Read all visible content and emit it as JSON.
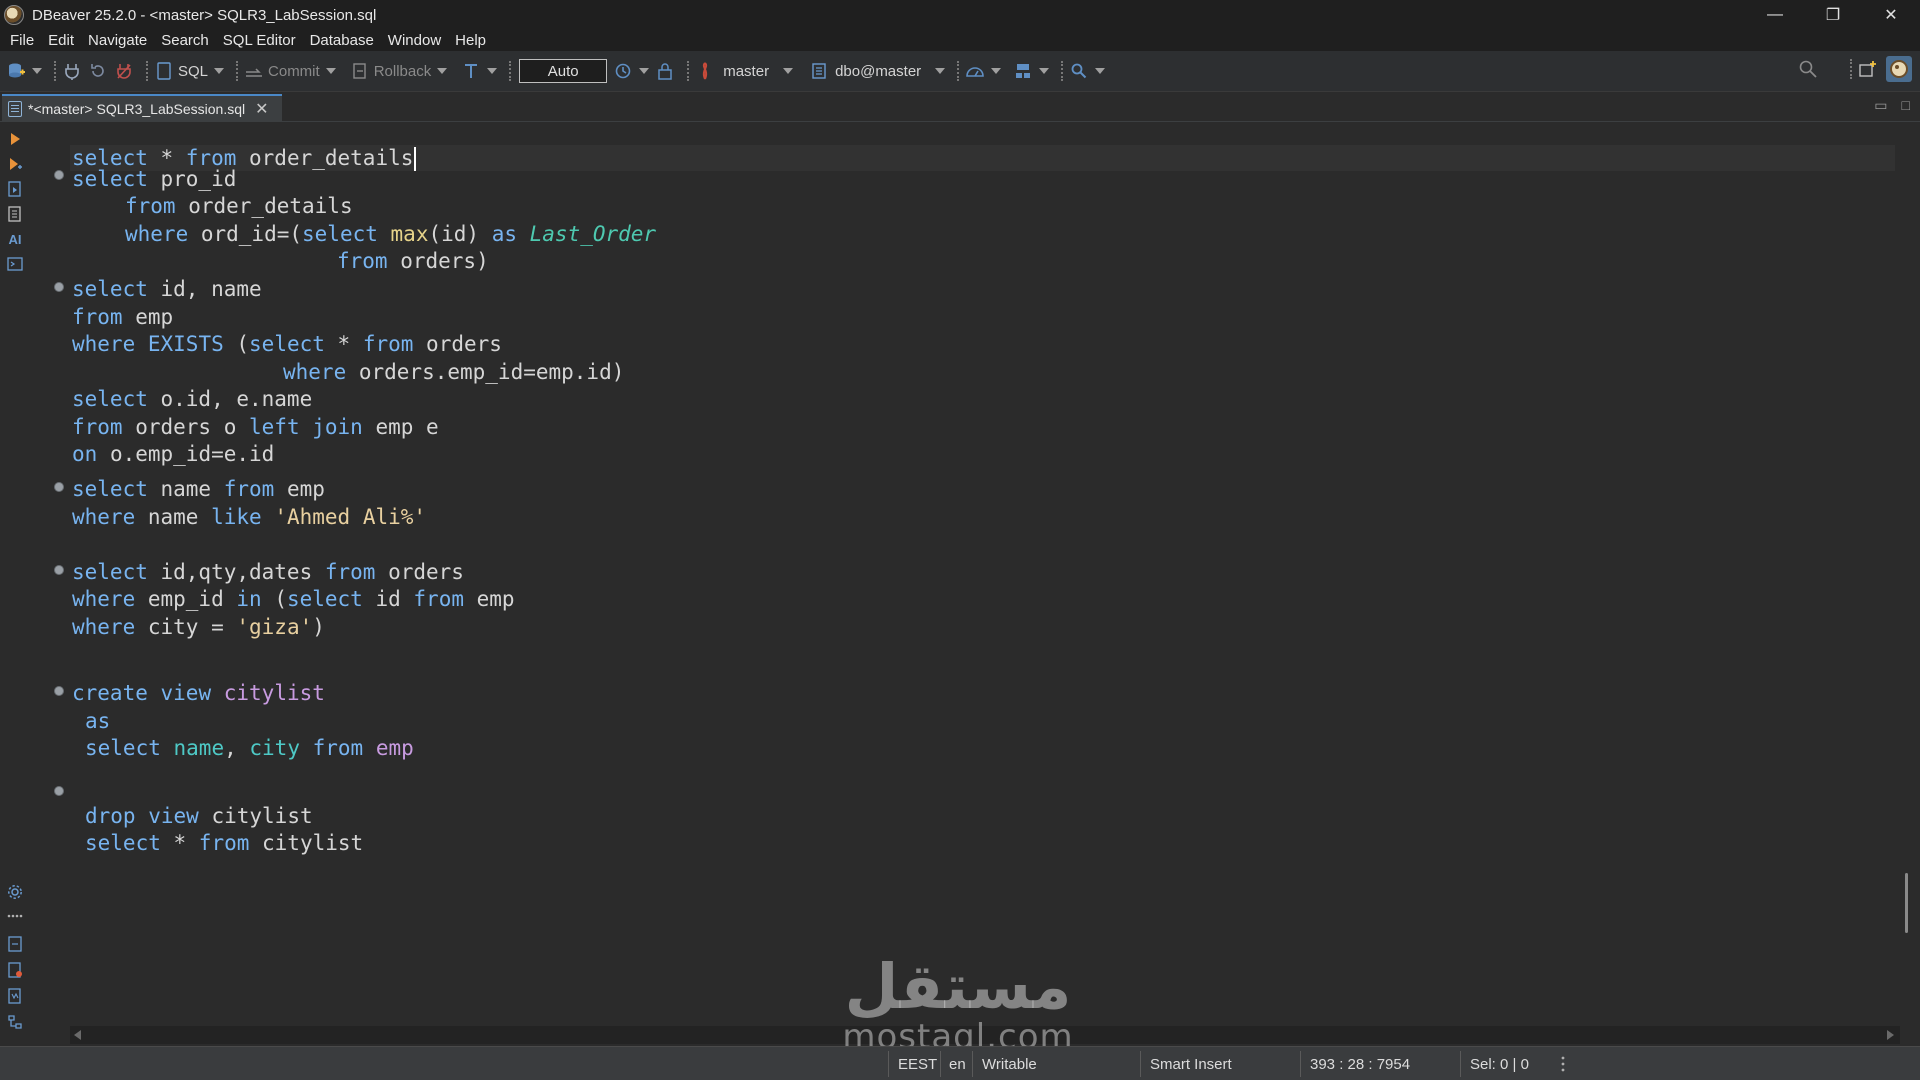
{
  "window": {
    "title": "DBeaver 25.2.0 - <master> SQLR3_LabSession.sql",
    "controls": {
      "minimize": "—",
      "restore": "❐",
      "close": "✕"
    }
  },
  "menu": [
    "File",
    "Edit",
    "Navigate",
    "Search",
    "SQL Editor",
    "Database",
    "Window",
    "Help"
  ],
  "toolbar": {
    "sql_label": "SQL",
    "commit_label": "Commit",
    "rollback_label": "Rollback",
    "transaction_mode": "Auto",
    "datasource": "master",
    "schema": "dbo@master"
  },
  "tab": {
    "label": "*<master> SQLR3_LabSession.sql",
    "close": "✕",
    "minimize": "▭",
    "maximize": "□"
  },
  "left_tools": {
    "ai_label": "AI"
  },
  "editor": {
    "line_1": {
      "kw1": "select",
      "t1": " * ",
      "kw2": "from",
      "t2": " order_details"
    },
    "block_subquery": {
      "l1": {
        "kw": "select",
        "t": " pro_id"
      },
      "l2": {
        "kw": "from",
        "t": " order_details"
      },
      "l3": {
        "kw1": "where",
        "t1": " ord_id=(",
        "kw2": "select",
        "sp": " ",
        "fn": "max",
        "t2": "(id) ",
        "kw3": "as",
        "sp2": " ",
        "alias": "Last_Order"
      },
      "l4": {
        "kw": "from",
        "t": " orders)"
      }
    },
    "block_exists": {
      "l1": {
        "kw": "select",
        "t": " id, name"
      },
      "l2": {
        "kw": "from",
        "t": " emp"
      },
      "l3": {
        "kw1": "where",
        "sp": " ",
        "kw2": "EXISTS",
        "t1": " (",
        "kw3": "select",
        "t2": " * ",
        "kw4": "from",
        "t3": " orders"
      },
      "l4": {
        "kw": "where",
        "t": " orders.emp_id=emp.id)"
      },
      "l5": {
        "kw": "select",
        "t": " o.id, e.name"
      },
      "l6": {
        "kw1": "from",
        "t1": " orders o ",
        "kw2": "left",
        "sp": " ",
        "kw3": "join",
        "t2": " emp e"
      },
      "l7": {
        "kw": "on",
        "t": " o.emp_id=e.id"
      }
    },
    "block_like": {
      "l1": {
        "kw1": "select",
        "t1": " name ",
        "kw2": "from",
        "t2": " emp"
      },
      "l2": {
        "kw1": "where",
        "t1": " name ",
        "kw2": "like",
        "sp": " ",
        "str": "'Ahmed Ali%'"
      }
    },
    "block_in": {
      "l1": {
        "kw1": "select",
        "t1": " id,qty,dates ",
        "kw2": "from",
        "t2": " orders"
      },
      "l2": {
        "kw1": "where",
        "t1": " emp_id ",
        "kw2": "in",
        "t2": " (",
        "kw3": "select",
        "t3": " id ",
        "kw4": "from",
        "t4": " emp"
      },
      "l3": {
        "kw": "where",
        "t": " city = ",
        "str": "'giza'",
        "t2": ")"
      }
    },
    "block_view": {
      "l1": {
        "kw1": "create",
        "sp": " ",
        "kw2": "view",
        "sp2": " ",
        "name": "citylist"
      },
      "l2": {
        "kw": "as"
      },
      "l3": {
        "kw1": "select",
        "sp": " ",
        "col1": "name",
        "t1": ", ",
        "col2": "city",
        "sp2": " ",
        "kw2": "from",
        "sp3": " ",
        "name": "emp"
      }
    },
    "block_drop": {
      "l1": {
        "kw1": "drop",
        "sp": " ",
        "kw2": "view",
        "t": " citylist"
      },
      "l2": {
        "kw1": "select",
        "t1": " * ",
        "kw2": "from",
        "t2": " citylist"
      }
    }
  },
  "watermark": {
    "arabic": "مستقل",
    "latin": "mostaql.com"
  },
  "status": {
    "timezone": "EEST",
    "locale": "en",
    "mode": "Writable",
    "insert_mode": "Smart Insert",
    "position": "393 : 28 : 7954",
    "selection": "Sel: 0 | 0"
  },
  "colors": {
    "keyword": "#78b4f0",
    "function": "#e6d38a",
    "alias": "#4ec9b0",
    "string": "#e8d0a0",
    "view_name": "#c89be0",
    "background": "#2b2b2b"
  }
}
